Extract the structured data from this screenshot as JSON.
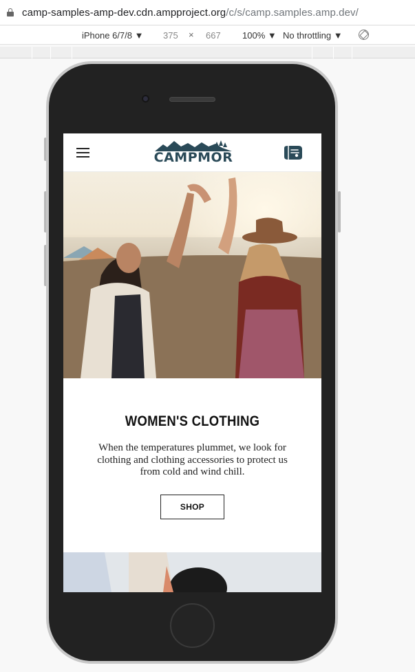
{
  "browser": {
    "url_host": "camp-samples-amp-dev.cdn.ampproject.org",
    "url_path": "/c/s/camp.samples.amp.dev/"
  },
  "devtools": {
    "device": "iPhone 6/7/8 ▼",
    "width": "375",
    "times": "×",
    "height": "667",
    "zoom": "100% ▼",
    "throttling": "No throttling ▼"
  },
  "site": {
    "logo": "CAMPMOR",
    "section_title": "WOMEN'S CLOTHING",
    "section_text": "When the temperatures plummet, we look for clothing and clothing accessories to protect us from cold and wind chill.",
    "shop_label": "SHOP"
  },
  "colors": {
    "brand": "#2a4a58",
    "phone_body": "#222222"
  },
  "icons": {
    "menu": "hamburger-menu-icon",
    "cart": "shopping-bag-icon",
    "lock": "lock-icon",
    "rotate": "rotate-icon"
  }
}
